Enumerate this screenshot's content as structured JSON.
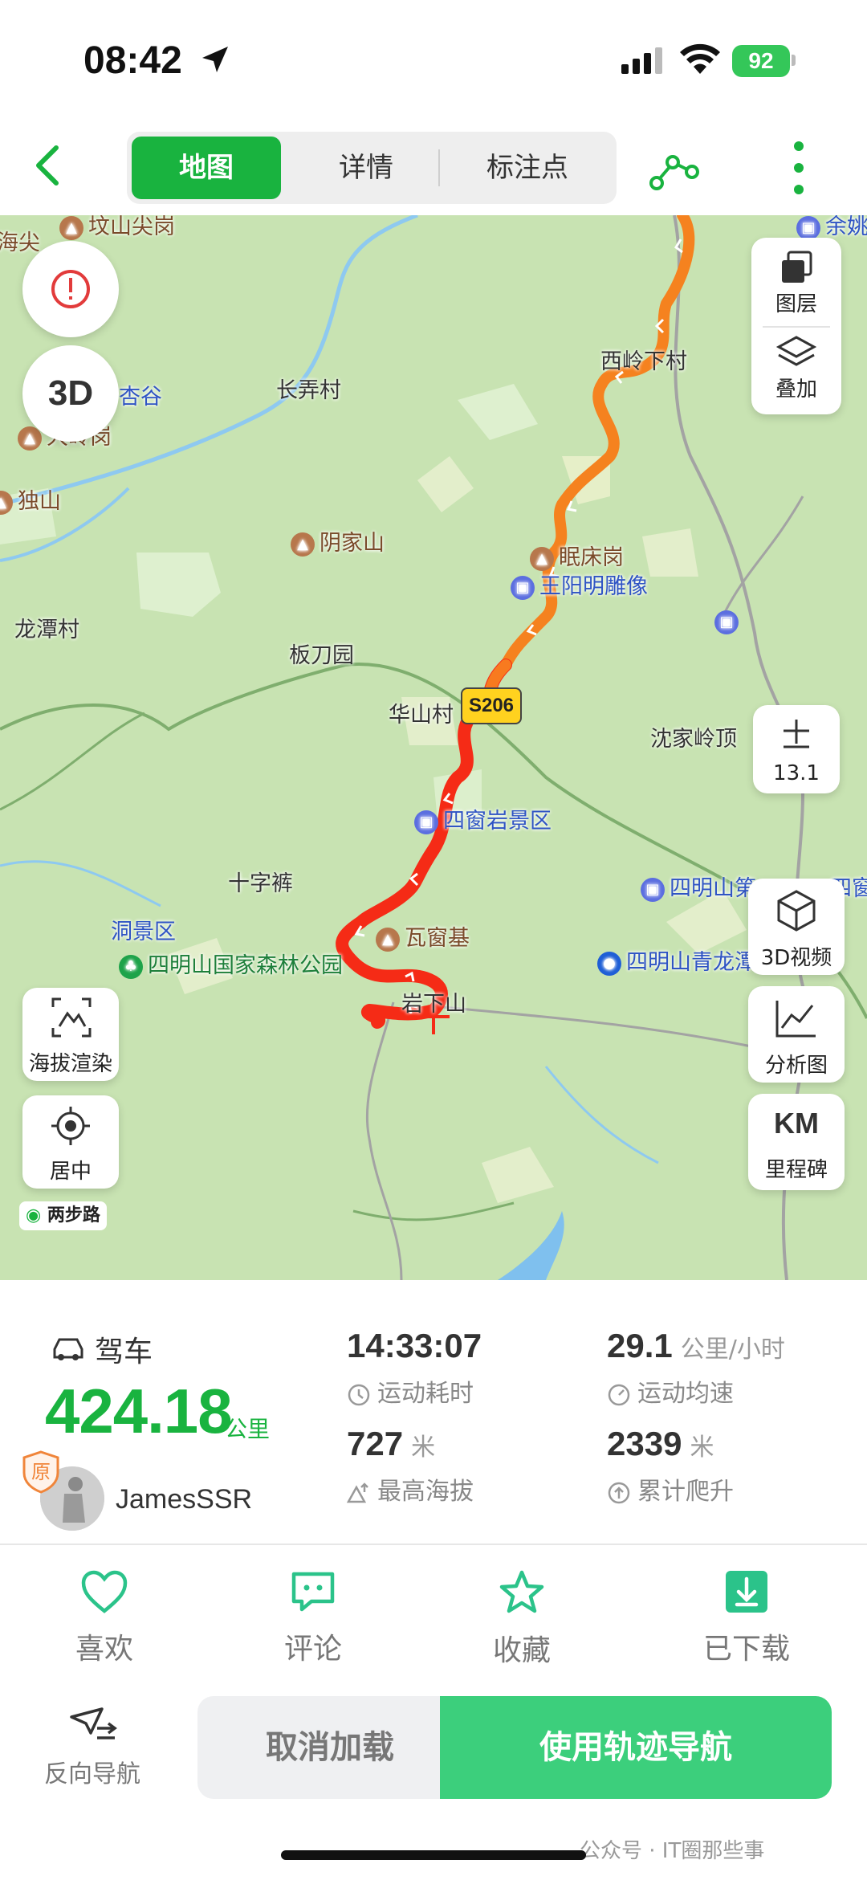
{
  "status_bar": {
    "time": "08:42",
    "battery": "92"
  },
  "nav": {
    "tabs": [
      "地图",
      "详情",
      "标注点"
    ],
    "active_tab": "地图"
  },
  "map": {
    "labels": {
      "wenshan": "坟山尖岗",
      "haijian": "海尖",
      "xinggu": "杏谷",
      "changnong": "长弄村",
      "dalingang": "大岭岗",
      "dushan": "独山",
      "xilingxia": "西岭下村",
      "yinjiashan": "阴家山",
      "mianchuang": "眠床岗",
      "wangyangming": "王阳明雕像",
      "longtan": "龙潭村",
      "bandaoyuan": "板刀园",
      "huashan": "华山村",
      "shenjialing": "沈家岭顶",
      "siwangyan": "四窗岩景区",
      "shizikun": "十字裤",
      "dongjingqu": "洞景区",
      "wachuangji": "瓦窗基",
      "forest_park": "四明山国家森林公园",
      "qinglongtan": "四明山青龙潭",
      "yanxiashan": "岩下山",
      "siming_di": "四明山第",
      "siming_cut": "四窗",
      "yuyao": "余姚"
    },
    "road_badge": "S206",
    "zoom_level": "13.1",
    "logo": "两步路",
    "controls": {
      "layer": "图层",
      "overlay": "叠加",
      "video3d": "3D视频",
      "analysis": "分析图",
      "km_icon": "KM",
      "milestone": "里程碑",
      "elevation": "海拔渲染",
      "center": "居中",
      "three_d": "3D"
    }
  },
  "stats": {
    "mode": "驾车",
    "distance": "424.18",
    "distance_unit": "公里",
    "original_badge": "原",
    "username": "JamesSSR",
    "duration": "14:33:07",
    "duration_label": "运动耗时",
    "avg_speed": "29.1",
    "avg_speed_unit": "公里/小时",
    "avg_speed_label": "运动均速",
    "max_alt": "727",
    "max_alt_unit": "米",
    "max_alt_label": "最高海拔",
    "climb": "2339",
    "climb_unit": "米",
    "climb_label": "累计爬升"
  },
  "actions": {
    "like": "喜欢",
    "comment": "评论",
    "favorite": "收藏",
    "downloaded": "已下载"
  },
  "bottom": {
    "reverse": "反向导航",
    "cancel": "取消加载",
    "navigate": "使用轨迹导航"
  },
  "watermark": "公众号 · IT圈那些事",
  "colors": {
    "accent_green": "#19b33f",
    "nav_button": "#3ccf7c",
    "track_red": "#f52b16",
    "track_orange": "#f5821f"
  }
}
